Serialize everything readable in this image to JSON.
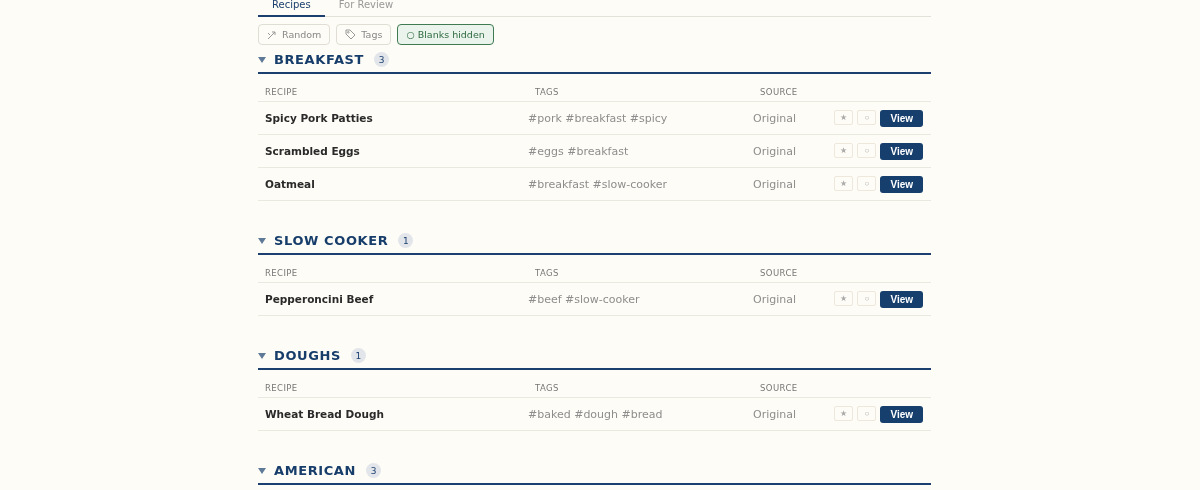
{
  "tabs": [
    {
      "label": "Recipes",
      "selected": true
    },
    {
      "label": "For Review",
      "selected": false
    }
  ],
  "toolbar": [
    {
      "kind": "random",
      "label": "Random",
      "active": false
    },
    {
      "kind": "tags",
      "label": "Tags",
      "active": false
    },
    {
      "kind": "blanks",
      "label": "○ Blanks hidden",
      "active": true
    }
  ],
  "sections": [
    {
      "title": "BREAKFAST",
      "count": "3",
      "expanded": true,
      "columns": [
        "RECIPE",
        "TAGS",
        "SOURCE"
      ],
      "rows": [
        {
          "recipe": "Spicy Pork Patties",
          "tags": "#pork #breakfast #spicy",
          "source": "Original",
          "star": "★",
          "dot": "○",
          "action": "View"
        },
        {
          "recipe": "Scrambled Eggs",
          "tags": "#eggs #breakfast",
          "source": "Original",
          "star": "★",
          "dot": "○",
          "action": "View"
        },
        {
          "recipe": "Oatmeal",
          "tags": "#breakfast #slow-cooker",
          "source": "Original",
          "star": "★",
          "dot": "○",
          "action": "View"
        }
      ]
    },
    {
      "title": "SLOW COOKER",
      "count": "1",
      "expanded": true,
      "columns": [
        "RECIPE",
        "TAGS",
        "SOURCE"
      ],
      "rows": [
        {
          "recipe": "Pepperoncini Beef",
          "tags": "#beef #slow-cooker",
          "source": "Original",
          "star": "★",
          "dot": "○",
          "action": "View"
        }
      ]
    },
    {
      "title": "DOUGHS",
      "count": "1",
      "expanded": true,
      "columns": [
        "RECIPE",
        "TAGS",
        "SOURCE"
      ],
      "rows": [
        {
          "recipe": "Wheat Bread Dough",
          "tags": "#baked #dough #bread",
          "source": "Original",
          "star": "★",
          "dot": "○",
          "action": "View"
        }
      ]
    },
    {
      "title": "AMERICAN",
      "count": "3",
      "expanded": true
    }
  ]
}
